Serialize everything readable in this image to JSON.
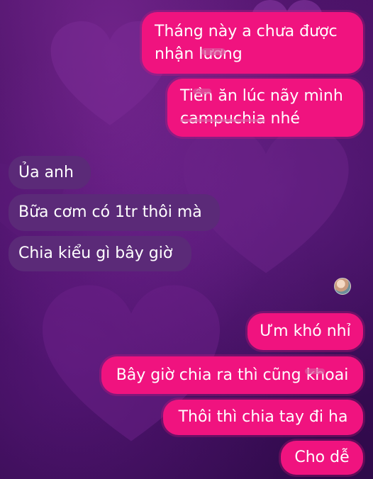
{
  "conversation": {
    "messages": [
      {
        "side": "sent",
        "lines": [
          "Tháng này a chưa được",
          "nhận lương"
        ]
      },
      {
        "side": "sent",
        "lines": [
          "Tiền ăn lúc nãy mình",
          "campuchia nhé"
        ]
      },
      {
        "side": "received",
        "text": "Ủa anh"
      },
      {
        "side": "received",
        "text": "Bữa cơm có 1tr thôi mà"
      },
      {
        "side": "received",
        "text": "Chia kiểu gì bây giờ"
      },
      {
        "side": "sent",
        "text": "Ưm khó nhỉ"
      },
      {
        "side": "sent",
        "text": "Bây giờ chia ra thì cũng khoai"
      },
      {
        "side": "sent",
        "text": "Thôi thì chia tay đi ha"
      },
      {
        "side": "sent",
        "text": "Cho dễ"
      }
    ]
  },
  "colors": {
    "sent_bubble": "#f0137f",
    "received_bubble": "#5b2a78",
    "background": "#3a0f57",
    "text": "#ffffff"
  },
  "icons": {
    "read_receipt": "avatar"
  }
}
